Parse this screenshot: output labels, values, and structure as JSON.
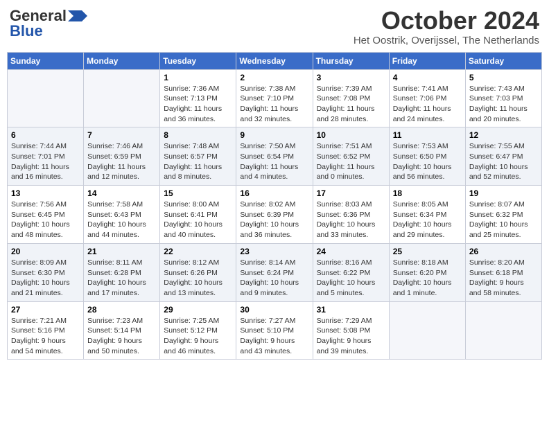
{
  "header": {
    "logo_general": "General",
    "logo_blue": "Blue",
    "month_title": "October 2024",
    "location": "Het Oostrik, Overijssel, The Netherlands"
  },
  "weekdays": [
    "Sunday",
    "Monday",
    "Tuesday",
    "Wednesday",
    "Thursday",
    "Friday",
    "Saturday"
  ],
  "weeks": [
    [
      {
        "day": "",
        "info": ""
      },
      {
        "day": "",
        "info": ""
      },
      {
        "day": "1",
        "info": "Sunrise: 7:36 AM\nSunset: 7:13 PM\nDaylight: 11 hours\nand 36 minutes."
      },
      {
        "day": "2",
        "info": "Sunrise: 7:38 AM\nSunset: 7:10 PM\nDaylight: 11 hours\nand 32 minutes."
      },
      {
        "day": "3",
        "info": "Sunrise: 7:39 AM\nSunset: 7:08 PM\nDaylight: 11 hours\nand 28 minutes."
      },
      {
        "day": "4",
        "info": "Sunrise: 7:41 AM\nSunset: 7:06 PM\nDaylight: 11 hours\nand 24 minutes."
      },
      {
        "day": "5",
        "info": "Sunrise: 7:43 AM\nSunset: 7:03 PM\nDaylight: 11 hours\nand 20 minutes."
      }
    ],
    [
      {
        "day": "6",
        "info": "Sunrise: 7:44 AM\nSunset: 7:01 PM\nDaylight: 11 hours\nand 16 minutes."
      },
      {
        "day": "7",
        "info": "Sunrise: 7:46 AM\nSunset: 6:59 PM\nDaylight: 11 hours\nand 12 minutes."
      },
      {
        "day": "8",
        "info": "Sunrise: 7:48 AM\nSunset: 6:57 PM\nDaylight: 11 hours\nand 8 minutes."
      },
      {
        "day": "9",
        "info": "Sunrise: 7:50 AM\nSunset: 6:54 PM\nDaylight: 11 hours\nand 4 minutes."
      },
      {
        "day": "10",
        "info": "Sunrise: 7:51 AM\nSunset: 6:52 PM\nDaylight: 11 hours\nand 0 minutes."
      },
      {
        "day": "11",
        "info": "Sunrise: 7:53 AM\nSunset: 6:50 PM\nDaylight: 10 hours\nand 56 minutes."
      },
      {
        "day": "12",
        "info": "Sunrise: 7:55 AM\nSunset: 6:47 PM\nDaylight: 10 hours\nand 52 minutes."
      }
    ],
    [
      {
        "day": "13",
        "info": "Sunrise: 7:56 AM\nSunset: 6:45 PM\nDaylight: 10 hours\nand 48 minutes."
      },
      {
        "day": "14",
        "info": "Sunrise: 7:58 AM\nSunset: 6:43 PM\nDaylight: 10 hours\nand 44 minutes."
      },
      {
        "day": "15",
        "info": "Sunrise: 8:00 AM\nSunset: 6:41 PM\nDaylight: 10 hours\nand 40 minutes."
      },
      {
        "day": "16",
        "info": "Sunrise: 8:02 AM\nSunset: 6:39 PM\nDaylight: 10 hours\nand 36 minutes."
      },
      {
        "day": "17",
        "info": "Sunrise: 8:03 AM\nSunset: 6:36 PM\nDaylight: 10 hours\nand 33 minutes."
      },
      {
        "day": "18",
        "info": "Sunrise: 8:05 AM\nSunset: 6:34 PM\nDaylight: 10 hours\nand 29 minutes."
      },
      {
        "day": "19",
        "info": "Sunrise: 8:07 AM\nSunset: 6:32 PM\nDaylight: 10 hours\nand 25 minutes."
      }
    ],
    [
      {
        "day": "20",
        "info": "Sunrise: 8:09 AM\nSunset: 6:30 PM\nDaylight: 10 hours\nand 21 minutes."
      },
      {
        "day": "21",
        "info": "Sunrise: 8:11 AM\nSunset: 6:28 PM\nDaylight: 10 hours\nand 17 minutes."
      },
      {
        "day": "22",
        "info": "Sunrise: 8:12 AM\nSunset: 6:26 PM\nDaylight: 10 hours\nand 13 minutes."
      },
      {
        "day": "23",
        "info": "Sunrise: 8:14 AM\nSunset: 6:24 PM\nDaylight: 10 hours\nand 9 minutes."
      },
      {
        "day": "24",
        "info": "Sunrise: 8:16 AM\nSunset: 6:22 PM\nDaylight: 10 hours\nand 5 minutes."
      },
      {
        "day": "25",
        "info": "Sunrise: 8:18 AM\nSunset: 6:20 PM\nDaylight: 10 hours\nand 1 minute."
      },
      {
        "day": "26",
        "info": "Sunrise: 8:20 AM\nSunset: 6:18 PM\nDaylight: 9 hours\nand 58 minutes."
      }
    ],
    [
      {
        "day": "27",
        "info": "Sunrise: 7:21 AM\nSunset: 5:16 PM\nDaylight: 9 hours\nand 54 minutes."
      },
      {
        "day": "28",
        "info": "Sunrise: 7:23 AM\nSunset: 5:14 PM\nDaylight: 9 hours\nand 50 minutes."
      },
      {
        "day": "29",
        "info": "Sunrise: 7:25 AM\nSunset: 5:12 PM\nDaylight: 9 hours\nand 46 minutes."
      },
      {
        "day": "30",
        "info": "Sunrise: 7:27 AM\nSunset: 5:10 PM\nDaylight: 9 hours\nand 43 minutes."
      },
      {
        "day": "31",
        "info": "Sunrise: 7:29 AM\nSunset: 5:08 PM\nDaylight: 9 hours\nand 39 minutes."
      },
      {
        "day": "",
        "info": ""
      },
      {
        "day": "",
        "info": ""
      }
    ]
  ]
}
